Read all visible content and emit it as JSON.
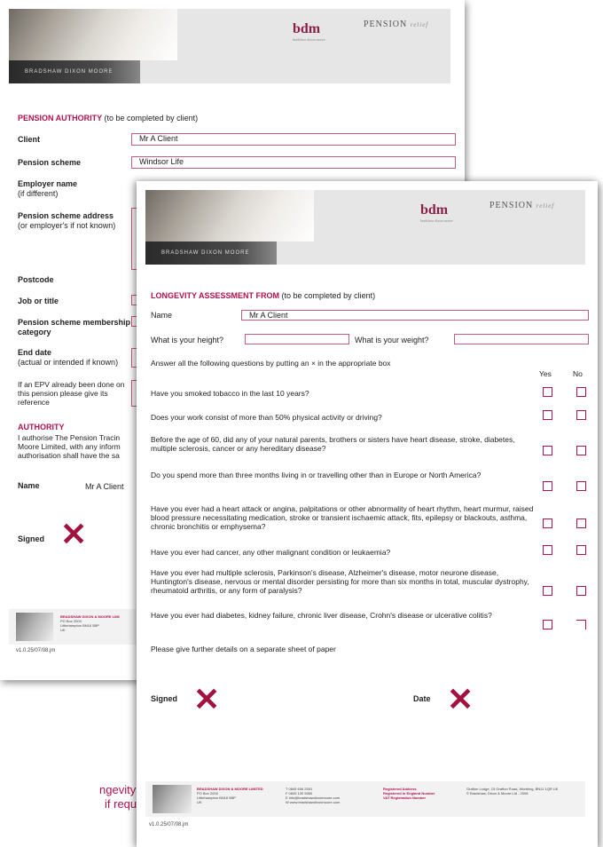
{
  "header": {
    "company": "BRADSHAW DIXON MOORE",
    "logo": "bdm",
    "logo_sub": "bradshaw dixon moore",
    "product": "PENSION",
    "product_suffix": "relief"
  },
  "authority": {
    "title": "PENSION AUTHORITY",
    "title_suffix": "(to be completed by client)",
    "client_label": "Client",
    "client_value": "Mr A Client",
    "scheme_label": "Pension scheme",
    "scheme_value": "Windsor Life",
    "employer_label": "Employer name",
    "employer_sub": "(if different)",
    "address_label": "Pension scheme address",
    "address_sub": "(or employer's if not known)",
    "postcode_label": "Postcode",
    "job_label": "Job or title",
    "membership_label": "Pension scheme membership category",
    "end_label": "End date",
    "end_sub": "(actual or intended if known)",
    "epv_text": "If an EPV already been done on this pension please give its reference",
    "auth_title": "AUTHORITY",
    "auth_text_1": "I authorise The Pension Tracin",
    "auth_text_2": "Moore Limited, with any inform",
    "auth_text_3": "authorisation shall have the sa",
    "name_label": "Name",
    "name_value": "Mr A Client",
    "signed_label": "Signed",
    "footer_company": "BRADSHAW DIXON & MOORE LIMI",
    "footer_addr1": "PO Box 2000",
    "footer_addr2": "Littlehampton BN16 5BP",
    "footer_addr3": "UK",
    "version": "v1.0.25/07/08.jm"
  },
  "longevity": {
    "title": "LONGEVITY ASSESSMENT FROM",
    "title_suffix": "(to be completed by client)",
    "name_label": "Name",
    "name_value": "Mr A Client",
    "height_label": "What is your height?",
    "weight_label": "What is your weight?",
    "instruction": "Answer all the following questions by putting an × in the appropriate box",
    "yes": "Yes",
    "no": "No",
    "questions": [
      "Have you smoked tobacco in the last 10 years?",
      "Does your work consist of more than 50% physical activity or driving?",
      "Before the age of 60, did any of your natural parents, brothers or sisters have heart disease, stroke, diabetes, multiple sclerosis, cancer or any hereditary disease?",
      "Do you spend more than three months living in or travelling other than in Europe or North America?",
      "Have you ever had a heart attack or angina, palpitations or other abnormality of heart rhythm, heart murmur, raised blood pressure necessitating medication, stroke or transient ischaemic attack, fits, epilepsy or blackouts, asthma, chronic bronchitis or emphysema?",
      "Have you ever had cancer, any other malignant condition or leukaemia?",
      "Have you ever had multiple sclerosis, Parkinson's disease, Alzheimer's disease, motor neurone disease, Huntington's disease, nervous or mental disorder persisting for more than six months in total, muscular dystrophy, rheumatoid arthritis, or any form of paralysis?",
      "Have you ever had diabetes, kidney failure, chronic liver disease, Crohn's disease or ulcerative colitis?"
    ],
    "further": "Please give further details on a separate sheet of paper",
    "signed_label": "Signed",
    "date_label": "Date",
    "footer_company": "BRADSHAW DIXON & MOORE LIMITED",
    "footer_addr1": "PO Box 2000",
    "footer_addr2": "Littlehampton BN16 5BP",
    "footer_addr3": "UK",
    "footer_t": "T 0845 606 2551",
    "footer_f": "F 0845 130 5050",
    "footer_e": "E info@bradshawdixonmoore.com",
    "footer_w": "W www.bradshawdixonmoore.com",
    "footer_reg": "Registered Address",
    "footer_reg2": "Registered in England Number",
    "footer_vat": "VAT Registration Number",
    "footer_regaddr": "Grafton Lodge, 15 Grafton Road, Worthing, BN11 1QR UK",
    "footer_copy": "© Bradshaw, Dixon & Moore Ltd - 2008",
    "version": "v1.0.25/07/08.jm"
  },
  "caption": {
    "line1": "ngevity forms",
    "line2": "if required)"
  }
}
